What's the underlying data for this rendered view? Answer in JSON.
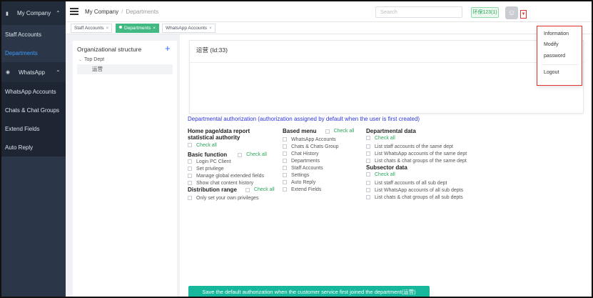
{
  "sidebar": {
    "company": "My Company",
    "items": [
      {
        "label": "Staff Accounts"
      },
      {
        "label": "Departments"
      }
    ],
    "whatsapp_group": "WhatsApp",
    "whatsapp_items": [
      {
        "label": "WhatsApp Accounts"
      },
      {
        "label": "Chats & Chat Groups"
      },
      {
        "label": "Extend Fields"
      },
      {
        "label": "Auto Reply"
      }
    ]
  },
  "header": {
    "breadcrumb_root": "My Company",
    "breadcrumb_sep": "/",
    "breadcrumb_current": "Departments",
    "search_placeholder": "Search",
    "user_badge": "环保123(1)"
  },
  "tabs": [
    {
      "label": "Staff Accounts",
      "close": "×"
    },
    {
      "label": "Departments",
      "close": "×"
    },
    {
      "label": "WhatsApp Accounts",
      "close": "×"
    }
  ],
  "tree": {
    "title": "Organizational structure",
    "add": "+",
    "root": "Top Dept",
    "child": "运营"
  },
  "main": {
    "card_title": "运营 (Id:33)",
    "auth_title": "Departmental authorization (authorization assigned by default when the user is first created)",
    "check_all": "Check all",
    "homepage": {
      "title_line1": "Home page/data report",
      "title_line2": "statistical authority"
    },
    "basic": {
      "title": "Basic function",
      "items": [
        "Login PC Client",
        "Set privilege",
        "Manage global extended fields",
        "Show chat content history"
      ]
    },
    "distribution": {
      "title": "Distribution range",
      "items": [
        "Only set your own privileges"
      ]
    },
    "based_menu": {
      "title": "Based menu",
      "items": [
        "WhatsApp Accounts",
        "Chats & Chats Group",
        "Chat History",
        "Departments",
        "Staff Accounts",
        "Settings",
        "Auto Reply",
        "Extend Fields"
      ]
    },
    "dept_data": {
      "title": "Departmental data",
      "items": [
        "List staff accounts of the same dept",
        "List WhatsApp accounts of the same dept",
        "List chats & chat groups of the same dept"
      ]
    },
    "subsector": {
      "title": "Subsector data",
      "items": [
        "List staff accounts of all sub dept",
        "List WhatsApp accounts of all sub depts",
        "List chats & chat groups of all sub depts"
      ]
    },
    "save_button": "Save the default authorization when the customer service first joined the department(运营)"
  },
  "dropdown": {
    "items": [
      "Information",
      "Modify",
      "password",
      "Logout"
    ]
  },
  "colors": {
    "sidebar_bg": "#2b3648",
    "accent_green": "#42b983",
    "active_link": "#3d9bff",
    "auth_title": "#2b35e0",
    "highlight_red": "#e0322f"
  }
}
